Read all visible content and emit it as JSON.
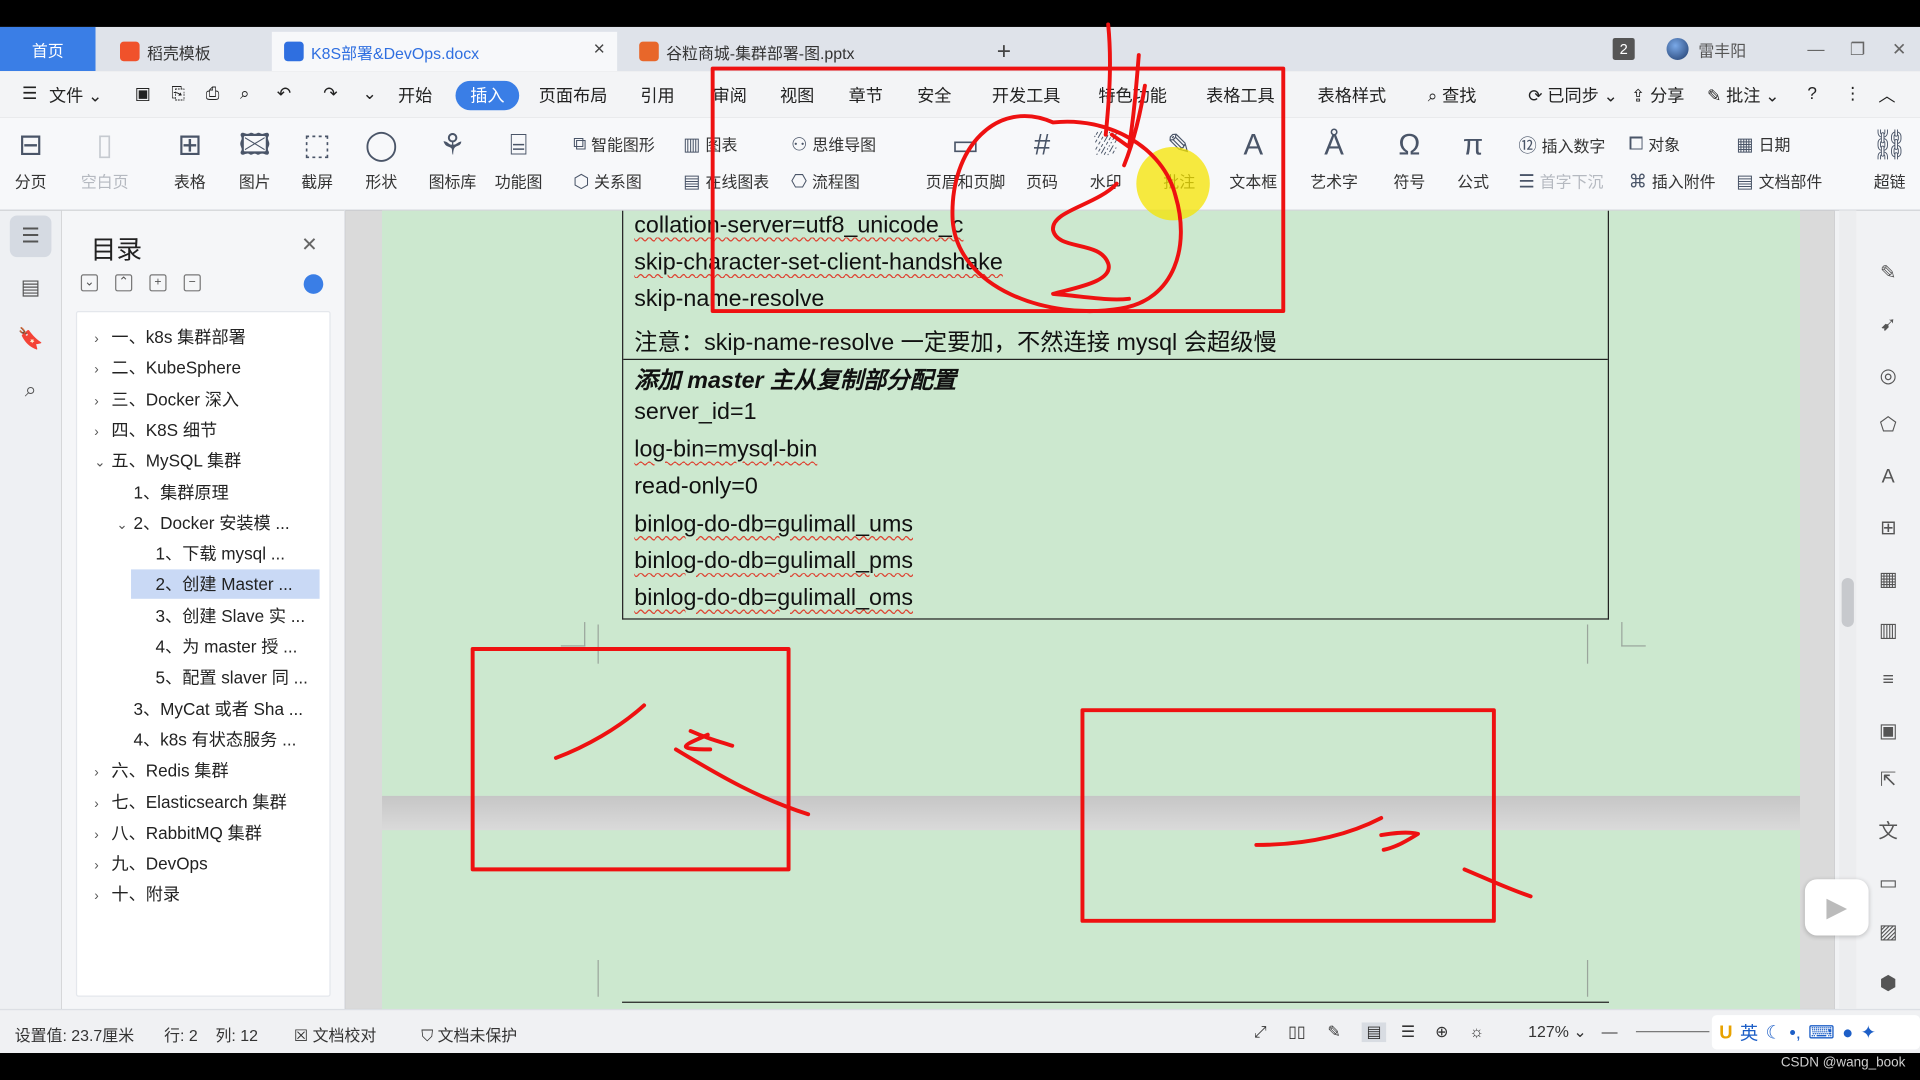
{
  "tabs": {
    "home": "首页",
    "daoke": "稻壳模板",
    "docx": "K8S部署&DevOps.docx",
    "pptx": "谷粒商城-集群部署-图.pptx",
    "new_tab": "+",
    "window_count": "2",
    "user": "雷丰阳"
  },
  "menu": {
    "file": "文件",
    "items": [
      "开始",
      "插入",
      "页面布局",
      "引用",
      "审阅",
      "视图",
      "章节",
      "安全",
      "开发工具",
      "特色功能",
      "表格工具",
      "表格样式"
    ],
    "active": "插入",
    "search": "查找",
    "synced": "已同步",
    "share": "分享",
    "comment": "批注"
  },
  "ribbon": {
    "page_break": "分页",
    "blank_page": "空白页",
    "table": "表格",
    "picture": "图片",
    "screenshot": "截屏",
    "shape": "形状",
    "icon_lib": "图标库",
    "function_chart": "功能图",
    "smart_shape": "智能图形",
    "chart": "图表",
    "mind_map": "思维导图",
    "relation_map": "关系图",
    "online_chart": "在线图表",
    "flowchart": "流程图",
    "header_footer": "页眉和页脚",
    "page_number": "页码",
    "watermark": "水印",
    "annotation": "批注",
    "text_box": "文本框",
    "word_art": "艺术字",
    "symbol": "符号",
    "formula": "公式",
    "insert_number": "插入数字",
    "object": "对象",
    "drop_cap": "首字下沉",
    "attachment": "插入附件",
    "date": "日期",
    "doc_parts": "文档部件",
    "hyperlink": "超链"
  },
  "toc": {
    "title": "目录",
    "items": [
      {
        "text": "一、k8s 集群部署",
        "level": 0,
        "expanded": false
      },
      {
        "text": "二、KubeSphere",
        "level": 0,
        "expanded": false
      },
      {
        "text": "三、Docker 深入",
        "level": 0,
        "expanded": false
      },
      {
        "text": "四、K8S 细节",
        "level": 0,
        "expanded": false
      },
      {
        "text": "五、MySQL 集群",
        "level": 0,
        "expanded": true
      },
      {
        "text": "1、集群原理",
        "level": 1,
        "expanded": null
      },
      {
        "text": "2、Docker 安装模 ...",
        "level": 1,
        "expanded": true
      },
      {
        "text": "1、下载 mysql ...",
        "level": 2,
        "expanded": null
      },
      {
        "text": "2、创建 Master ...",
        "level": 2,
        "expanded": null,
        "selected": true
      },
      {
        "text": "3、创建 Slave 实 ...",
        "level": 2,
        "expanded": null
      },
      {
        "text": "4、为 master 授 ...",
        "level": 2,
        "expanded": null
      },
      {
        "text": "5、配置 slaver 同 ...",
        "level": 2,
        "expanded": null
      },
      {
        "text": "3、MyCat 或者 Sha ...",
        "level": 1,
        "expanded": null
      },
      {
        "text": "4、k8s 有状态服务 ...",
        "level": 1,
        "expanded": null
      },
      {
        "text": "六、Redis 集群",
        "level": 0,
        "expanded": false
      },
      {
        "text": "七、Elasticsearch 集群",
        "level": 0,
        "expanded": false
      },
      {
        "text": "八、RabbitMQ 集群",
        "level": 0,
        "expanded": false
      },
      {
        "text": "九、DevOps",
        "level": 0,
        "expanded": false
      },
      {
        "text": "十、附录",
        "level": 0,
        "expanded": false
      }
    ]
  },
  "document": {
    "lines": [
      {
        "text": "collation-server=utf8_unicode_c",
        "bold": false,
        "squiggle": true
      },
      {
        "text": "skip-character-set-client-handshake",
        "bold": false,
        "squiggle": true
      },
      {
        "text": "skip-name-resolve",
        "bold": false,
        "squiggle": false
      },
      {
        "text": "注意：skip-name-resolve 一定要加，不然连接 mysql 会超级慢",
        "bold": false,
        "squiggle": false
      },
      {
        "text": "添加 master 主从复制部分配置",
        "bold": true,
        "squiggle": false
      },
      {
        "text": "server_id=1",
        "bold": false,
        "squiggle": false
      },
      {
        "text": "log-bin=mysql-bin",
        "bold": false,
        "squiggle": true
      },
      {
        "text": "read-only=0",
        "bold": false,
        "squiggle": false
      },
      {
        "text": "binlog-do-db=gulimall_ums",
        "bold": false,
        "squiggle": true
      },
      {
        "text": "binlog-do-db=gulimall_pms",
        "bold": false,
        "squiggle": true
      },
      {
        "text": "binlog-do-db=gulimall_oms",
        "bold": false,
        "squiggle": true
      }
    ]
  },
  "status": {
    "setting_value": "设置值: 23.7厘米",
    "row": "行: 2",
    "col": "列: 12",
    "proofread": "文档校对",
    "unprotected": "文档未保护",
    "zoom": "127%"
  },
  "ime": {
    "lang": "英"
  },
  "watermark": "CSDN @wang_book",
  "colors": {
    "accent": "#3a7ee6",
    "page_bg": "#cce8cf",
    "annotation": "#ee1111",
    "highlight": "#f5e400"
  }
}
